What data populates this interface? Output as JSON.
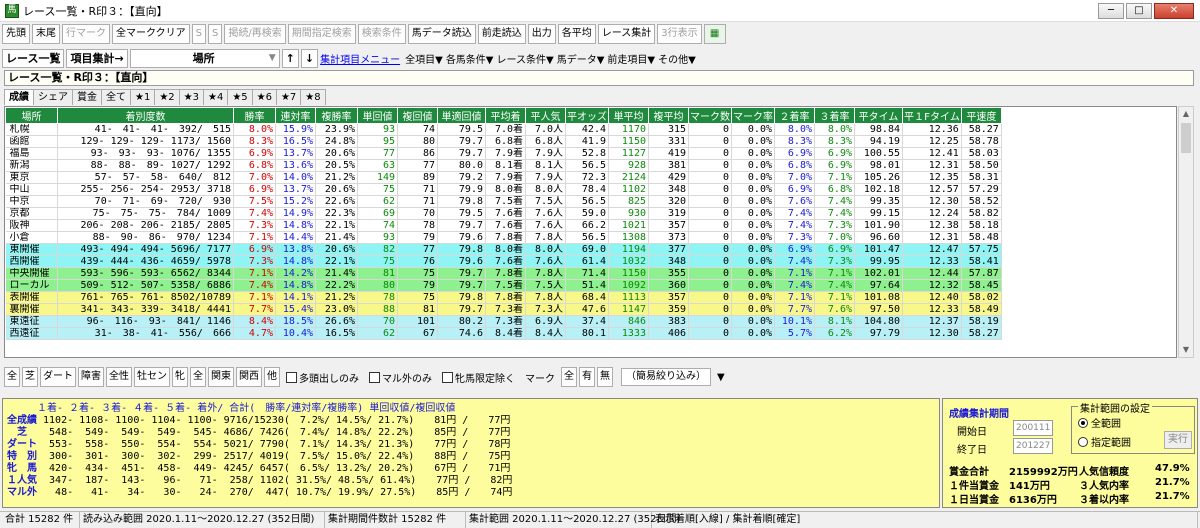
{
  "window": {
    "title": "レース一覧・R印３：【直向】",
    "icon": "app-icon"
  },
  "toolbar": {
    "items": [
      {
        "label": "先頭",
        "disabled": false
      },
      {
        "label": "末尾",
        "disabled": false
      },
      {
        "label": "行マーク",
        "disabled": true
      },
      {
        "label": "全マーククリア",
        "disabled": false
      },
      {
        "label": "S",
        "disabled": true
      },
      {
        "label": "S",
        "disabled": true
      },
      {
        "label": "掲続/再検索",
        "disabled": true
      },
      {
        "label": "期間指定検索",
        "disabled": true
      },
      {
        "label": "検索条件",
        "disabled": true
      },
      {
        "label": "馬データ読込",
        "disabled": false
      },
      {
        "label": "前走読込",
        "disabled": false
      },
      {
        "label": "出力",
        "disabled": false
      },
      {
        "label": "各平均",
        "disabled": false
      },
      {
        "label": "レース集計",
        "disabled": false
      },
      {
        "label": "3行表示",
        "disabled": true
      }
    ],
    "excel_icon": "spreadsheet-icon"
  },
  "row2": {
    "race_list": "レース一覧",
    "item_agg": "項目集計→",
    "combo_value": "場所",
    "sort_up": "↑",
    "sort_down": "↓",
    "menu_link": "集計項目メニュー",
    "menus": [
      "全項目▼",
      "各馬条件▼",
      "レース条件▼",
      "馬データ▼",
      "前走項目▼",
      "その他▼"
    ]
  },
  "title_box": "レース一覧・R印３：【直向】",
  "tabs": [
    "成績",
    "シェア",
    "賞金",
    "全て",
    "★1",
    "★2",
    "★3",
    "★4",
    "★5",
    "★6",
    "★7",
    "★8"
  ],
  "grid": {
    "headers": [
      "場所",
      "着別度数",
      "勝率",
      "連対率",
      "複勝率",
      "単回値",
      "複回値",
      "単適回値",
      "平均着",
      "平人気",
      "平オッズ",
      "単平均",
      "複平均",
      "マーク数",
      "マーク率",
      "２着率",
      "３着率",
      "平タイム",
      "平１Fタイム",
      "平速度"
    ],
    "rows": [
      {
        "style": "",
        "c": [
          "札幌",
          "41-　41-　41-　392/　515",
          "8.0%",
          "15.9%",
          "23.9%",
          "93",
          "74",
          "79.5",
          "7.0着",
          "7.0人",
          "42.4",
          "1170",
          "315",
          "0",
          "0.0%",
          "8.0%",
          "8.0%",
          "98.84",
          "12.36",
          "58.27"
        ]
      },
      {
        "style": "",
        "c": [
          "函館",
          "129- 129- 129- 1173/ 1560",
          "8.3%",
          "16.5%",
          "24.8%",
          "95",
          "80",
          "79.7",
          "6.8着",
          "6.8人",
          "41.9",
          "1150",
          "331",
          "0",
          "0.0%",
          "8.3%",
          "8.3%",
          "94.19",
          "12.25",
          "58.78"
        ]
      },
      {
        "style": "",
        "c": [
          "福島",
          "93-　93-　93- 1076/ 1355",
          "6.9%",
          "13.7%",
          "20.6%",
          "77",
          "86",
          "79.7",
          "7.9着",
          "7.9人",
          "52.8",
          "1127",
          "419",
          "0",
          "0.0%",
          "6.9%",
          "6.9%",
          "100.55",
          "12.41",
          "58.03"
        ]
      },
      {
        "style": "",
        "c": [
          "新潟",
          "88-　88-　89- 1027/ 1292",
          "6.8%",
          "13.6%",
          "20.5%",
          "63",
          "77",
          "80.0",
          "8.1着",
          "8.1人",
          "56.5",
          "928",
          "381",
          "0",
          "0.0%",
          "6.8%",
          "6.9%",
          "98.01",
          "12.31",
          "58.50"
        ]
      },
      {
        "style": "",
        "c": [
          "東京",
          "57-　57-　58-　640/　812",
          "7.0%",
          "14.0%",
          "21.2%",
          "149",
          "89",
          "79.2",
          "7.9着",
          "7.9人",
          "72.3",
          "2124",
          "429",
          "0",
          "0.0%",
          "7.0%",
          "7.1%",
          "105.26",
          "12.35",
          "58.31"
        ]
      },
      {
        "style": "",
        "c": [
          "中山",
          "255- 256- 254- 2953/ 3718",
          "6.9%",
          "13.7%",
          "20.6%",
          "75",
          "71",
          "79.9",
          "8.0着",
          "8.0人",
          "78.4",
          "1102",
          "348",
          "0",
          "0.0%",
          "6.9%",
          "6.8%",
          "102.18",
          "12.57",
          "57.29"
        ]
      },
      {
        "style": "",
        "c": [
          "中京",
          "70-　71-　69-　720/　930",
          "7.5%",
          "15.2%",
          "22.6%",
          "62",
          "71",
          "79.8",
          "7.5着",
          "7.5人",
          "56.5",
          "825",
          "320",
          "0",
          "0.0%",
          "7.6%",
          "7.4%",
          "99.35",
          "12.30",
          "58.52"
        ]
      },
      {
        "style": "",
        "c": [
          "京都",
          "75-　75-　75-　784/ 1009",
          "7.4%",
          "14.9%",
          "22.3%",
          "69",
          "70",
          "79.5",
          "7.6着",
          "7.6人",
          "59.0",
          "930",
          "319",
          "0",
          "0.0%",
          "7.4%",
          "7.4%",
          "99.15",
          "12.24",
          "58.82"
        ]
      },
      {
        "style": "",
        "c": [
          "阪神",
          "206- 208- 206- 2185/ 2805",
          "7.3%",
          "14.8%",
          "22.1%",
          "74",
          "78",
          "79.7",
          "7.6着",
          "7.6人",
          "66.2",
          "1021",
          "357",
          "0",
          "0.0%",
          "7.4%",
          "7.3%",
          "101.90",
          "12.38",
          "58.18"
        ]
      },
      {
        "style": "",
        "c": [
          "小倉",
          "88-　90-　86-　970/ 1234",
          "7.1%",
          "14.4%",
          "21.4%",
          "93",
          "79",
          "79.6",
          "7.8着",
          "7.8人",
          "56.5",
          "1308",
          "373",
          "0",
          "0.0%",
          "7.3%",
          "7.0%",
          "96.60",
          "12.31",
          "58.48"
        ]
      },
      {
        "style": "r-cyan",
        "c": [
          "東開催",
          "493- 494- 494- 5696/ 7177",
          "6.9%",
          "13.8%",
          "20.6%",
          "82",
          "77",
          "79.8",
          "8.0着",
          "8.0人",
          "69.0",
          "1194",
          "377",
          "0",
          "0.0%",
          "6.9%",
          "6.9%",
          "101.47",
          "12.47",
          "57.75"
        ]
      },
      {
        "style": "r-cyan",
        "c": [
          "西開催",
          "439- 444- 436- 4659/ 5978",
          "7.3%",
          "14.8%",
          "22.1%",
          "75",
          "76",
          "79.6",
          "7.6着",
          "7.6人",
          "61.4",
          "1032",
          "348",
          "0",
          "0.0%",
          "7.4%",
          "7.3%",
          "99.95",
          "12.33",
          "58.41"
        ]
      },
      {
        "style": "r-green",
        "c": [
          "中央開催",
          "593- 596- 593- 6562/ 8344",
          "7.1%",
          "14.2%",
          "21.4%",
          "81",
          "75",
          "79.7",
          "7.8着",
          "7.8人",
          "71.4",
          "1150",
          "355",
          "0",
          "0.0%",
          "7.1%",
          "7.1%",
          "102.01",
          "12.44",
          "57.87"
        ]
      },
      {
        "style": "r-green",
        "c": [
          "ローカル",
          "509- 512- 507- 5358/ 6886",
          "7.4%",
          "14.8%",
          "22.2%",
          "80",
          "79",
          "79.7",
          "7.5着",
          "7.5人",
          "51.4",
          "1092",
          "360",
          "0",
          "0.0%",
          "7.4%",
          "7.4%",
          "97.64",
          "12.32",
          "58.45"
        ]
      },
      {
        "style": "r-yellow",
        "c": [
          "表開催",
          "761- 765- 761- 8502/10789",
          "7.1%",
          "14.1%",
          "21.2%",
          "78",
          "75",
          "79.8",
          "7.8着",
          "7.8人",
          "68.4",
          "1113",
          "357",
          "0",
          "0.0%",
          "7.1%",
          "7.1%",
          "101.08",
          "12.40",
          "58.02"
        ]
      },
      {
        "style": "r-yellow",
        "c": [
          "裏開催",
          "341- 343- 339- 3418/ 4441",
          "7.7%",
          "15.4%",
          "23.0%",
          "88",
          "81",
          "79.7",
          "7.3着",
          "7.3人",
          "47.6",
          "1147",
          "359",
          "0",
          "0.0%",
          "7.7%",
          "7.6%",
          "97.50",
          "12.33",
          "58.49"
        ]
      },
      {
        "style": "r-cyan2",
        "c": [
          "東遠征",
          "96-　116-　93-　841/ 1146",
          "8.4%",
          "18.5%",
          "26.6%",
          "70",
          "101",
          "80.2",
          "7.3着",
          "6.9人",
          "37.4",
          "846",
          "383",
          "0",
          "0.0%",
          "10.1%",
          "8.1%",
          "104.80",
          "12.37",
          "58.19"
        ]
      },
      {
        "style": "r-cyan2",
        "c": [
          "西遠征",
          "31-　38-　41-　556/　666",
          "4.7%",
          "10.4%",
          "16.5%",
          "62",
          "67",
          "74.6",
          "8.4着",
          "8.4人",
          "80.1",
          "1333",
          "406",
          "0",
          "0.0%",
          "5.7%",
          "6.2%",
          "97.79",
          "12.30",
          "58.27"
        ]
      }
    ]
  },
  "filterbar": {
    "buttons": [
      "全",
      "芝",
      "ダート",
      "障害",
      "全性",
      "牡セン",
      "牝",
      "全",
      "関東",
      "関西",
      "他"
    ],
    "checks": [
      "多頭出しのみ",
      "マル外のみ",
      "牝馬限定除く"
    ],
    "mark_label": "マーク",
    "mark_btns": [
      "全",
      "有",
      "無"
    ],
    "simple_filter": "（簡易絞り込み）"
  },
  "summary": {
    "header": "　　　１着- ２着- ３着- ４着- ５着- 着外/ 合計(　勝率/連対率/複勝率) 単回収値/複回収値",
    "rows": [
      {
        "label": "全成績",
        "data": " 1102- 1108- 1100- 1104- 1100- 9716/15230(　7.2%/ 14.5%/ 21.7%)　　81円 /　　77円"
      },
      {
        "label": "　芝　",
        "data": "  548-  549-  549-  549-  545- 4686/ 7426(　7.4%/ 14.8%/ 22.2%)　　85円 /　　77円"
      },
      {
        "label": "ダート",
        "data": "  553-  558-  550-  554-  554- 5021/ 7790(　7.1%/ 14.3%/ 21.3%)　　77円 /　　78円"
      },
      {
        "label": "特　別",
        "data": "  300-  301-  300-  302-  299- 2517/ 4019(　7.5%/ 15.0%/ 22.4%)　　88円 /　　75円"
      },
      {
        "label": "牝　馬",
        "data": "  420-  434-  451-  458-  449- 4245/ 6457(　6.5%/ 13.2%/ 20.2%)　　67円 /　　71円"
      },
      {
        "label": "１人気",
        "data": "  347-  187-  143-   96-   71-  258/ 1102( 31.5%/ 48.5%/ 61.4%)　　77円 /　　82円"
      },
      {
        "label": "マル外",
        "data": "   48-   41-   34-   30-   24-  270/  447( 10.7%/ 19.9%/ 27.5%)　　85円 /　　74円"
      }
    ]
  },
  "side": {
    "title": "成績集計期間",
    "start_label": "開始日",
    "start_val": "200111",
    "end_label": "終了日",
    "end_val": "201227",
    "range_title": "集計範囲の設定",
    "radio_all": "全範囲",
    "radio_custom": "指定範囲",
    "exec": "実行",
    "stats": [
      [
        "賞金合計",
        "2159992万円",
        "人気信頼度",
        "47.9%"
      ],
      [
        "１件当賞金",
        "141万円",
        "３人気内率",
        "21.7%"
      ],
      [
        "１日当賞金",
        "6136万円",
        "３着以内率",
        "21.7%"
      ]
    ]
  },
  "status": [
    "合計 15282 件",
    "読み込み範囲 2020.1.11～2020.12.27 (352日間)",
    "集計期間件数計 15282 件",
    "集計範囲 2020.1.11～2020.12.27 (352日間)",
    "表示着順[入線] / 集計着順[確定]"
  ]
}
